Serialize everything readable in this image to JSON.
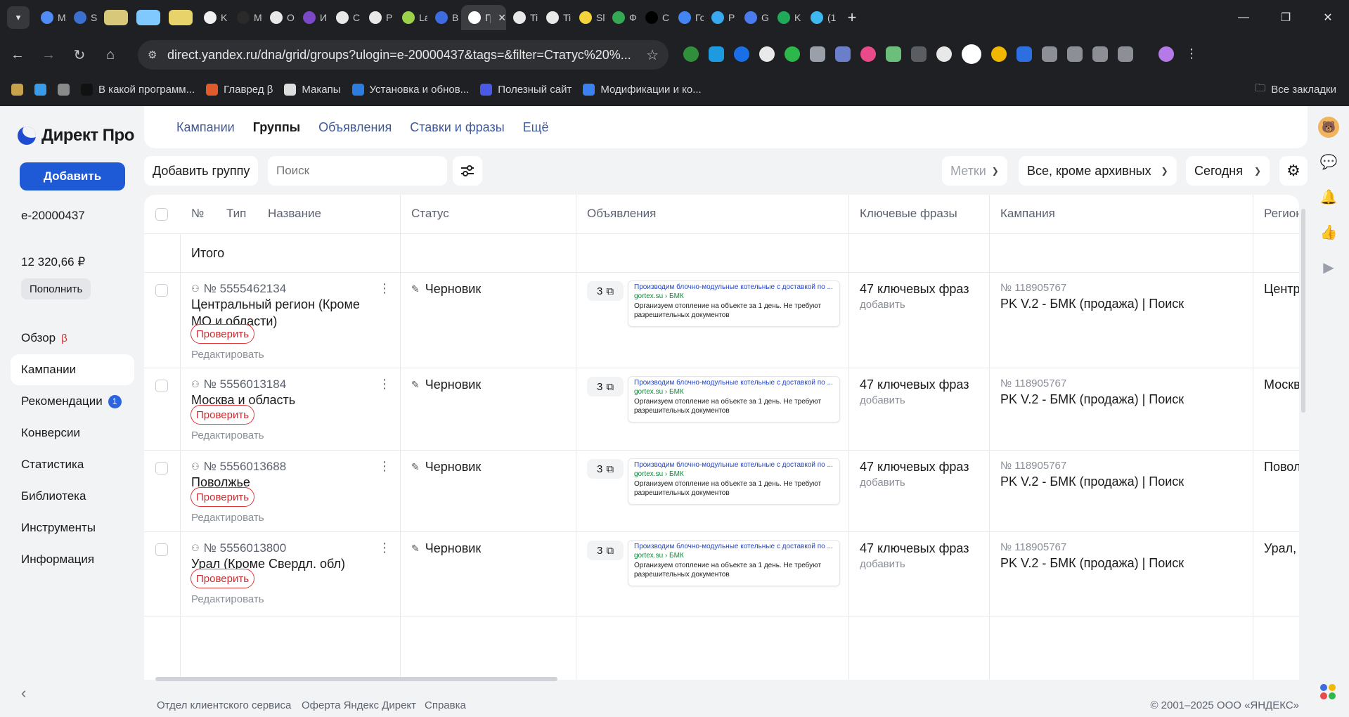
{
  "browser": {
    "tabs": [
      {
        "title": "M",
        "color": "#4f8cf5"
      },
      {
        "title": "S",
        "color": "#3b6fd1"
      },
      {
        "title": "",
        "color": "#d8c87a",
        "pinned": true
      },
      {
        "title": "",
        "color": "#7fc9ff",
        "pinned": true
      },
      {
        "title": "",
        "color": "#e8d26a",
        "pinned": true
      },
      {
        "title": "K",
        "color": "#f0f0f0"
      },
      {
        "title": "M",
        "color": "#2a2a2a"
      },
      {
        "title": "O",
        "color": "#e8e8e8"
      },
      {
        "title": "И",
        "color": "#7b48c8"
      },
      {
        "title": "C",
        "color": "#e8e8e8"
      },
      {
        "title": "P",
        "color": "#e8e8e8"
      },
      {
        "title": "La",
        "color": "#9bd24a"
      },
      {
        "title": "B",
        "color": "#3d6be0"
      },
      {
        "title": "Гр",
        "color": "#ffffff",
        "active": true
      },
      {
        "title": "Ti",
        "color": "#e8e8e8"
      },
      {
        "title": "Ti",
        "color": "#e8e8e8"
      },
      {
        "title": "Sl",
        "color": "#f4d23c"
      },
      {
        "title": "Ф",
        "color": "#34a853"
      },
      {
        "title": "C",
        "color": "#000000"
      },
      {
        "title": "Го",
        "color": "#4285f4"
      },
      {
        "title": "P",
        "color": "#38a8f0"
      },
      {
        "title": "G",
        "color": "#4a7cf0"
      },
      {
        "title": "K",
        "color": "#1faa59"
      },
      {
        "title": "(1",
        "color": "#3fb8f0"
      }
    ],
    "close_glyph": "✕",
    "new_tab_glyph": "+",
    "url": "direct.yandex.ru/dna/grid/groups?ulogin=e-20000437&tags=&filter=Статус%20%...",
    "bookmarks": [
      {
        "label": "",
        "color": "#c8a24a"
      },
      {
        "label": "",
        "color": "#3a9be8"
      },
      {
        "label": "",
        "color": "#8a8a8a"
      },
      {
        "label": "В какой программ...",
        "color": "#111111"
      },
      {
        "label": "Главред β",
        "color": "#e05a2a"
      },
      {
        "label": "Макапы",
        "color": "#dddddd"
      },
      {
        "label": "Установка и обнов...",
        "color": "#2d7de0"
      },
      {
        "label": "Полезный сайт",
        "color": "#4a5ae8"
      },
      {
        "label": "Модификации и ко...",
        "color": "#3a82f0"
      }
    ],
    "all_bookmarks": "Все закладки"
  },
  "sidebar": {
    "logo_text": "Директ Про",
    "add_label": "Добавить",
    "login": "e-20000437",
    "balance": "12 320,66 ₽",
    "topup_label": "Пополнить",
    "menu": [
      {
        "label": "Обзор",
        "beta": "β"
      },
      {
        "label": "Кампании",
        "active": true
      },
      {
        "label": "Рекомендации",
        "badge": "1"
      },
      {
        "label": "Конверсии"
      },
      {
        "label": "Статистика"
      },
      {
        "label": "Библиотека"
      },
      {
        "label": "Инструменты"
      },
      {
        "label": "Информация"
      }
    ],
    "collapse_glyph": "‹"
  },
  "top_tabs": [
    "Кампании",
    "Группы",
    "Объявления",
    "Ставки и фразы",
    "Ещё"
  ],
  "active_tab": "Группы",
  "filters": {
    "add_group": "Добавить группу",
    "search_placeholder": "Поиск",
    "tags": "Метки",
    "archive_filter": "Все, кроме архивных",
    "period": "Сегодня"
  },
  "table": {
    "headers": {
      "num": "№",
      "type": "Тип",
      "name": "Название",
      "status": "Статус",
      "ads": "Объявления",
      "keywords": "Ключевые фразы",
      "campaign": "Кампания",
      "region": "Регион"
    },
    "total_label": "Итого",
    "check_label": "Проверить",
    "edit_label": "Редактировать",
    "kw_add_label": "добавить",
    "rows": [
      {
        "id": "№ 5555462134",
        "name": "Центральный регион (Кроме МО и области)",
        "status": "Черновик",
        "ads_count": "3",
        "ad_title": "Производим блочно-модульные котельные с доставкой по ...",
        "ad_url": "gortex.su › БМК",
        "ad_text": "Организуем отопление на объекте за 1 день. Не требуют разрешительных документов",
        "keywords": "47 ключевых фраз",
        "campaign_id": "№ 118905767",
        "campaign_name": "PK V.2 - БМК (продажа) | Поиск",
        "region": "Центр"
      },
      {
        "id": "№ 5556013184",
        "name": "Москва и область",
        "status": "Черновик",
        "ads_count": "3",
        "ad_title": "Производим блочно-модульные котельные с доставкой по ...",
        "ad_url": "gortex.su › БМК",
        "ad_text": "Организуем отопление на объекте за 1 день. Не требуют разрешительных документов",
        "keywords": "47 ключевых фраз",
        "campaign_id": "№ 118905767",
        "campaign_name": "PK V.2 - БМК (продажа) | Поиск",
        "region": "Москв"
      },
      {
        "id": "№ 5556013688",
        "name": "Поволжье",
        "status": "Черновик",
        "ads_count": "3",
        "ad_title": "Производим блочно-модульные котельные с доставкой по ...",
        "ad_url": "gortex.su › БМК",
        "ad_text": "Организуем отопление на объекте за 1 день. Не требуют разрешительных документов",
        "keywords": "47 ключевых фраз",
        "campaign_id": "№ 118905767",
        "campaign_name": "PK V.2 - БМК (продажа) | Поиск",
        "region": "Повол"
      },
      {
        "id": "№ 5556013800",
        "name": "Урал (Кроме Свердл. обл)",
        "status": "Черновик",
        "ads_count": "3",
        "ad_title": "Производим блочно-модульные котельные с доставкой по ...",
        "ad_url": "gortex.su › БМК",
        "ad_text": "Организуем отопление на объекте за 1 день. Не требуют разрешительных документов",
        "keywords": "47 ключевых фраз",
        "campaign_id": "№ 118905767",
        "campaign_name": "PK V.2 - БМК (продажа) | Поиск",
        "region": "Урал, "
      }
    ]
  },
  "footer": {
    "links": [
      "Отдел клиентского сервиса",
      "Оферта Яндекс Директ",
      "Справка"
    ],
    "copyright": "© 2001–2025 ООО «ЯНДЕКС»"
  },
  "icons": {
    "tab_menu": "chevron-down-icon",
    "back": "arrow-left-icon",
    "forward": "arrow-right-icon",
    "reload": "reload-icon",
    "home": "home-icon",
    "settings": "gear-icon",
    "filters": "sliders-icon"
  }
}
